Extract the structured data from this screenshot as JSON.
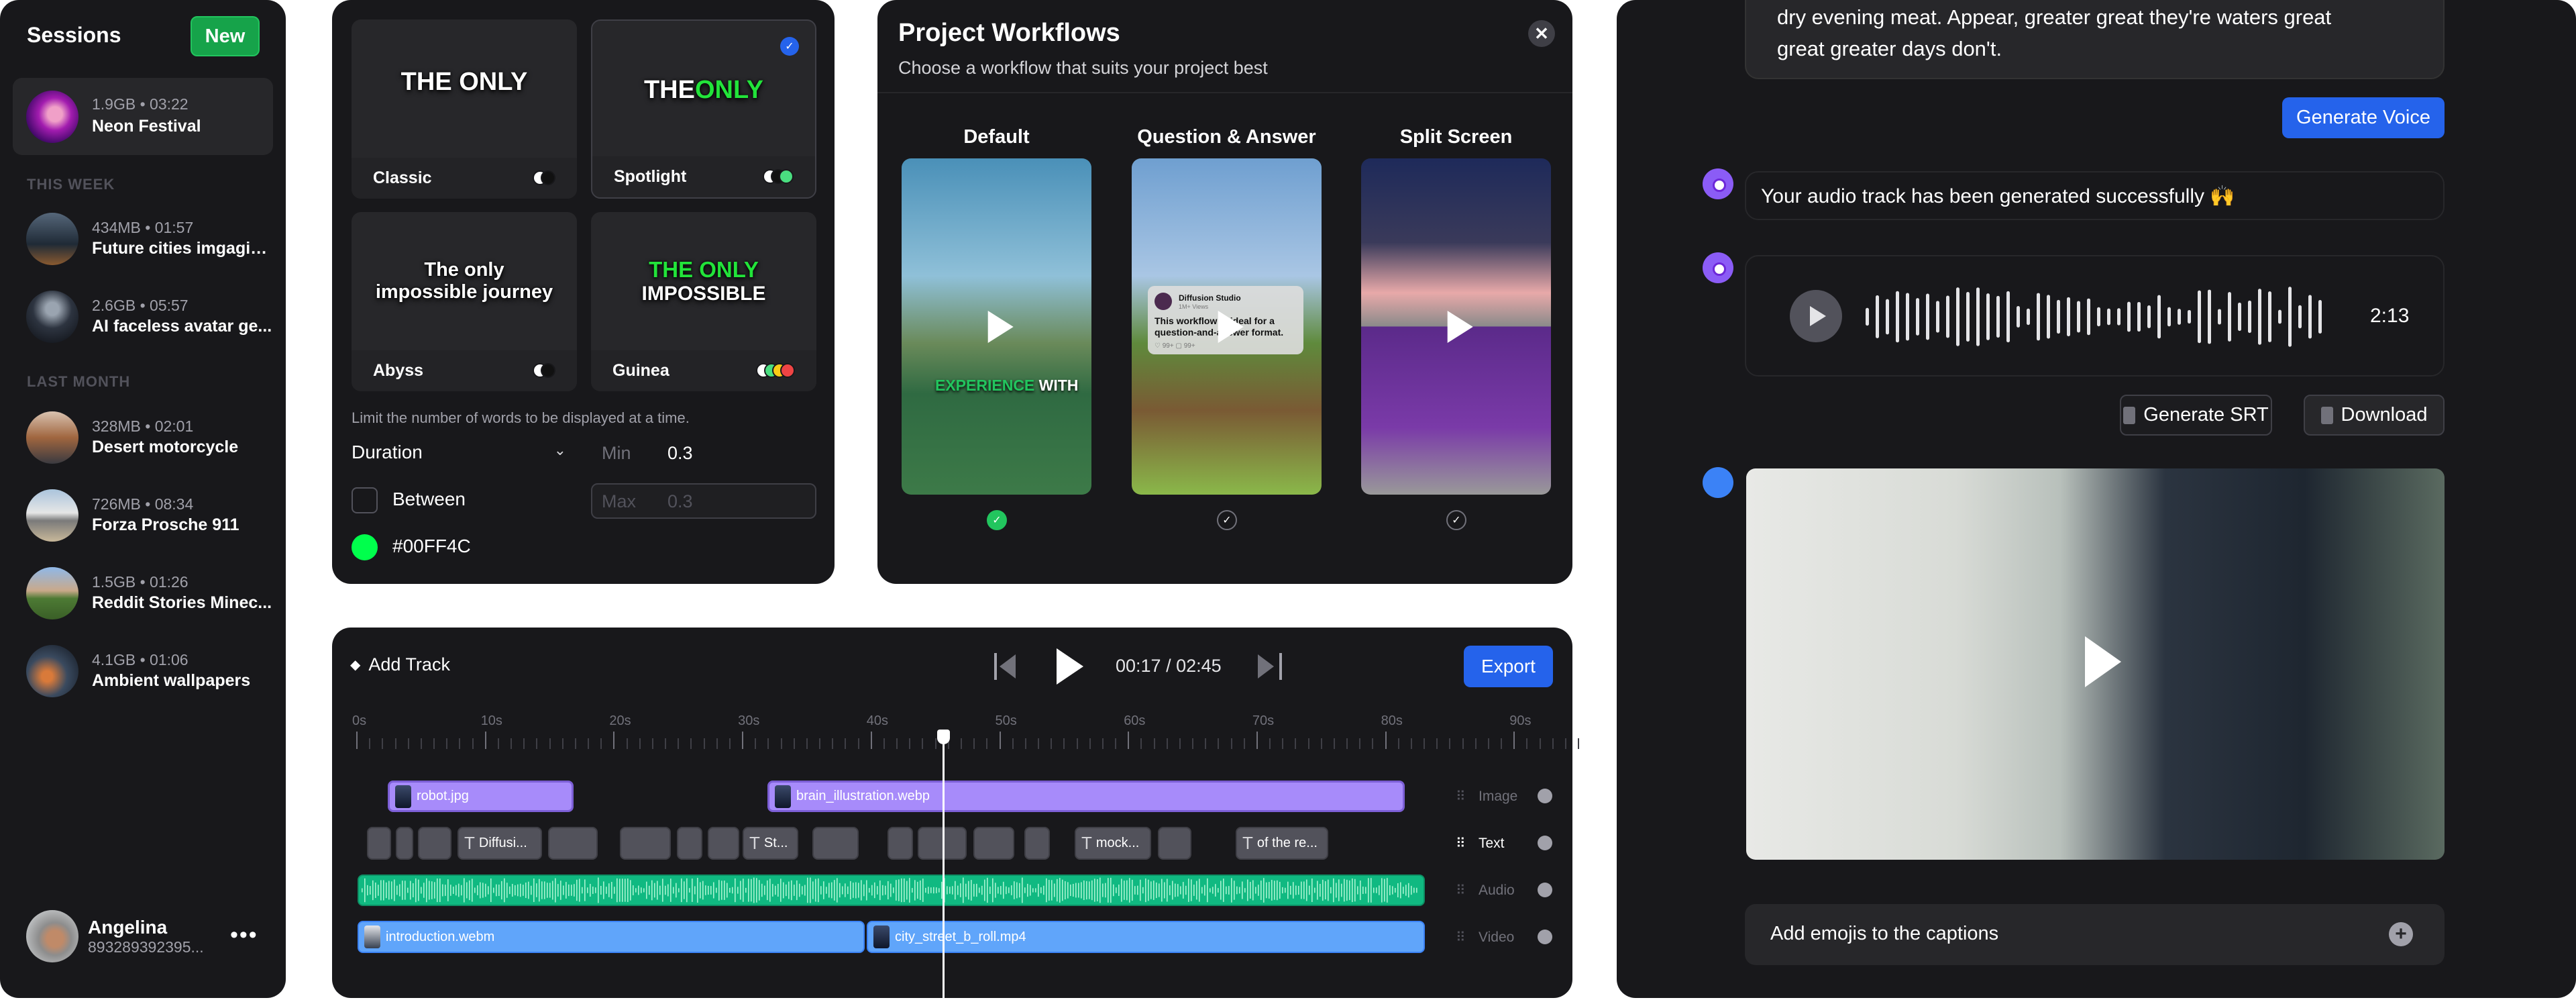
{
  "sessions": {
    "title": "Sessions",
    "new_label": "New",
    "current": {
      "meta": "1.9GB • 03:22",
      "name": "Neon Festival"
    },
    "this_week_label": "THIS WEEK",
    "this_week": [
      {
        "meta": "434MB • 01:57",
        "name": "Future cities imgagin..."
      },
      {
        "meta": "2.6GB • 05:57",
        "name": "AI faceless avatar ge..."
      }
    ],
    "last_month_label": "LAST MONTH",
    "last_month": [
      {
        "meta": "328MB • 02:01",
        "name": "Desert motorcycle"
      },
      {
        "meta": "726MB • 08:34",
        "name": "Forza Prosche 911"
      },
      {
        "meta": "1.5GB • 01:26",
        "name": "Reddit Stories Minec..."
      },
      {
        "meta": "4.1GB • 01:06",
        "name": "Ambient wallpapers"
      }
    ],
    "user": {
      "name": "Angelina",
      "id": "893289392395...",
      "more_icon": "ellipsis-icon"
    }
  },
  "captions": {
    "styles": [
      {
        "name": "Classic",
        "preview": "THE ONLY",
        "colors": [
          "#ffffff"
        ]
      },
      {
        "name": "Spotlight",
        "preview_a": "THE ",
        "preview_b": "ONLY",
        "selected": true,
        "colors": [
          "#ffffff",
          "#4ade80"
        ]
      },
      {
        "name": "Abyss",
        "preview": "The only impossible journey",
        "colors": [
          "#ffffff"
        ]
      },
      {
        "name": "Guinea",
        "preview_a": "THE ONLY",
        "preview_b": "IMPOSSIBLE",
        "colors": [
          "#ffffff",
          "#4ade80",
          "#facc15",
          "#ef4444"
        ]
      }
    ],
    "hint": "Limit the number of words to be displayed at a time.",
    "duration_label": "Duration",
    "min_label": "Min",
    "min_value": "0.3",
    "between_label": "Between",
    "between_checked": false,
    "max_label": "Max",
    "max_value": "0.3",
    "color_value": "#00FF4C"
  },
  "workflows": {
    "title": "Project Workflows",
    "subtitle": "Choose a workflow that suits your project best",
    "options": [
      {
        "label": "Default",
        "selected": true,
        "overlay_a": "EXPERIENCE",
        "overlay_b": " WITH"
      },
      {
        "label": "Question & Answer",
        "selected": false,
        "post_author": "Diffusion Studio",
        "post_views": "1M+ Views",
        "post_text": "This workflow is ideal for a question-and-answer format.",
        "likes": "99+",
        "comments": "99+"
      },
      {
        "label": "Split Screen",
        "selected": false
      }
    ]
  },
  "timeline": {
    "add_track": "Add Track",
    "time": "00:17 / 02:45",
    "export": "Export",
    "ruler": [
      "0s",
      "10s",
      "20s",
      "30s",
      "40s",
      "50s",
      "60s",
      "70s",
      "80s",
      "90s"
    ],
    "image_clips": [
      "robot.jpg",
      "brain_illustration.webp"
    ],
    "text_clips": [
      "Diffusi...",
      "St...",
      "mock...",
      "of the re..."
    ],
    "video_clips": [
      "introduction.webm",
      "city_street_b_roll.mp4"
    ],
    "tracks": [
      "Image",
      "Text",
      "Audio",
      "Video"
    ]
  },
  "chat": {
    "prompt_lines": [
      "dry evening meat. Appear, greater great they're waters great",
      "great greater days don't."
    ],
    "generate_voice": "Generate Voice",
    "success": "Your audio track has been generated successfully 🙌",
    "audio_duration": "2:13",
    "generate_srt": "Generate SRT",
    "download": "Download",
    "emoji_prompt": "Add emojis to the captions"
  },
  "colors": {
    "accent": "#2563eb",
    "new_button": "#16a34a",
    "image_track": "#a78bfa",
    "audio_track": "#10b981",
    "video_track": "#60a5fa"
  }
}
